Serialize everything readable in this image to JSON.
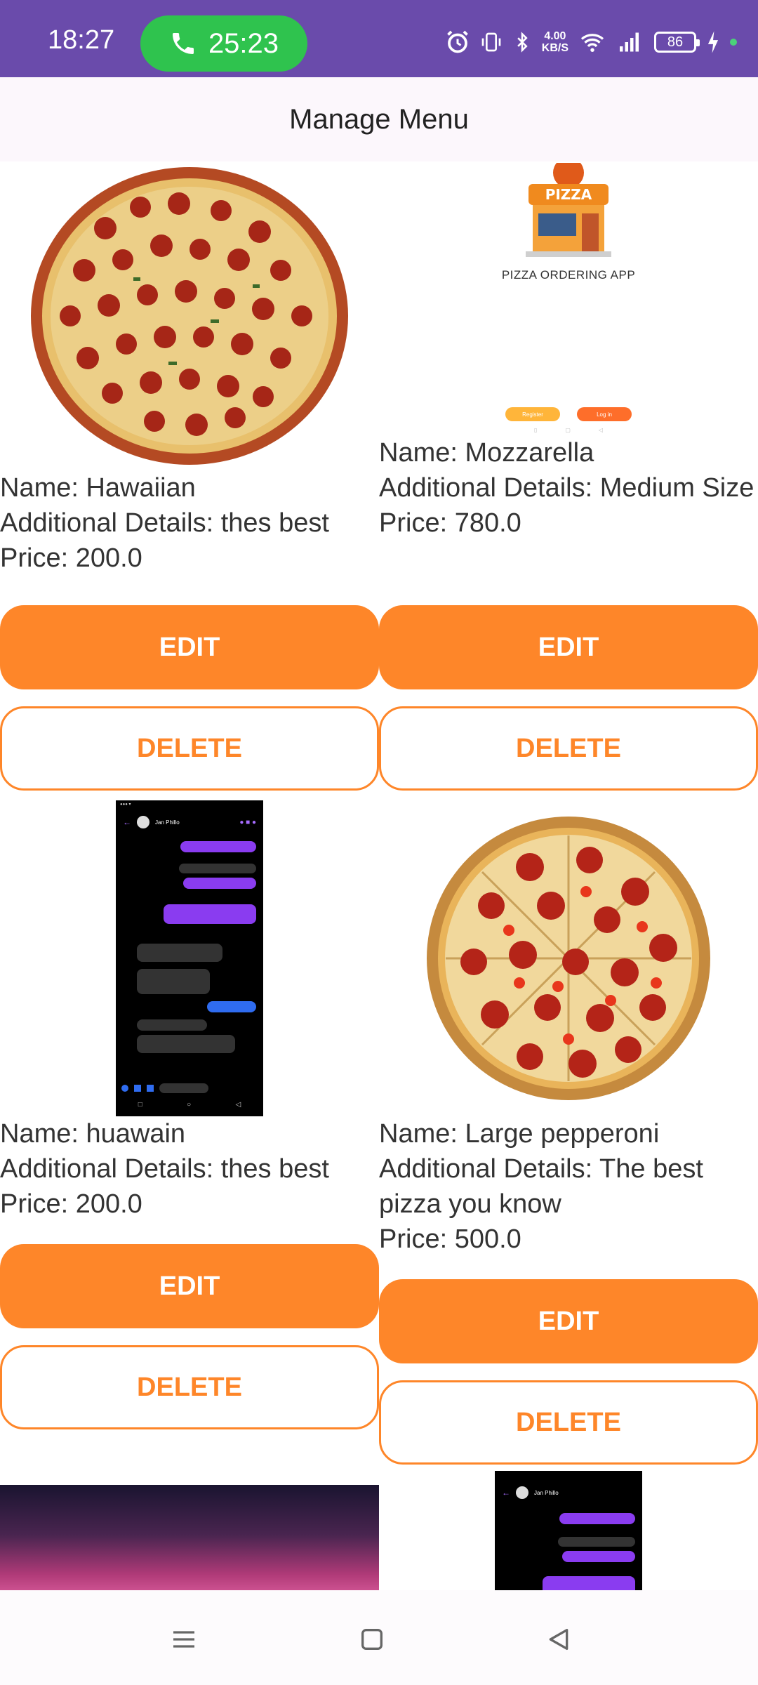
{
  "status_bar": {
    "time": "18:27",
    "call_timer": "25:23",
    "net_speed_value": "4.00",
    "net_speed_unit": "KB/S",
    "battery": "86"
  },
  "app_bar": {
    "title": "Manage Menu"
  },
  "labels": {
    "name_prefix": "Name: ",
    "details_prefix": "Additional Details: ",
    "price_prefix": "Price: ",
    "edit": "EDIT",
    "delete": "DELETE"
  },
  "products": [
    {
      "name": "Name: Hawaiian",
      "details": "Additional Details: thes best",
      "price": "Price: 200.0",
      "image": "pepperoni-pizza-photo"
    },
    {
      "name": "Name: Mozzarella",
      "details": "Additional Details: Medium Size",
      "price": "Price: 780.0",
      "image": "pizza-app-splash-screenshot",
      "image_text": "PIZZA ORDERING APP",
      "image_badge": "PIZZA",
      "image_btn1": "Register",
      "image_btn2": "Log in"
    },
    {
      "name": "Name: huawain",
      "details": "Additional Details: thes best",
      "price": "Price: 200.0",
      "image": "messenger-chat-screenshot",
      "chat_contact": "Jan Phillo"
    },
    {
      "name": "Name: Large pepperoni",
      "details": "Additional Details: The best pizza you know",
      "price": "Price: 500.0",
      "image": "large-pepperoni-pizza-photo"
    }
  ],
  "partial_images": [
    {
      "image": "aurora-sky-photo"
    },
    {
      "image": "messenger-chat-screenshot",
      "chat_contact": "Jan Phillo"
    }
  ],
  "colors": {
    "status_bar": "#6a4bab",
    "accent": "#fe8629",
    "call_pill": "#2fc34e",
    "app_bar": "#fcf7fc"
  }
}
